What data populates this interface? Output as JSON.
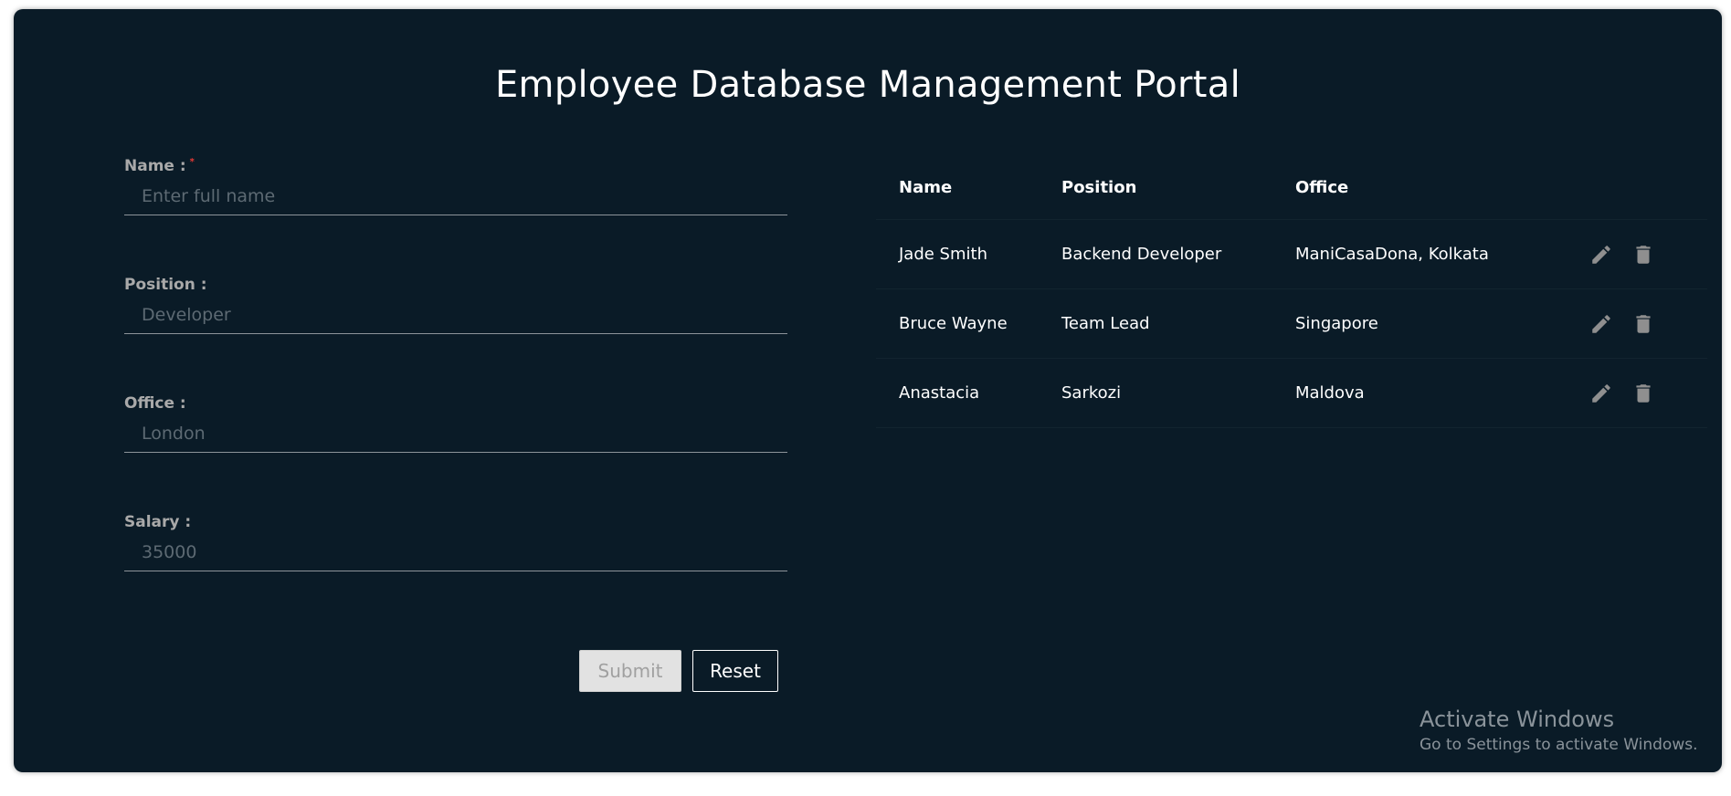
{
  "page": {
    "title": "Employee Database Management Portal"
  },
  "colors": {
    "background": "#0a1b27",
    "text": "#ffffff",
    "label": "#a9a9a9",
    "required": "#e53935",
    "icon": "#8f8f8f"
  },
  "form": {
    "name": {
      "label": "Name :",
      "required_mark": "*",
      "placeholder": "Enter full name",
      "value": ""
    },
    "position": {
      "label": "Position :",
      "placeholder": "Developer",
      "value": ""
    },
    "office": {
      "label": "Office :",
      "placeholder": "London",
      "value": ""
    },
    "salary": {
      "label": "Salary :",
      "placeholder": "35000",
      "value": ""
    },
    "submit_label": "Submit",
    "reset_label": "Reset"
  },
  "table": {
    "headers": {
      "name": "Name",
      "position": "Position",
      "office": "Office"
    },
    "rows": [
      {
        "name": "Jade Smith",
        "position": "Backend Developer",
        "office": "ManiCasaDona, Kolkata"
      },
      {
        "name": "Bruce Wayne",
        "position": "Team Lead",
        "office": "Singapore"
      },
      {
        "name": "Anastacia",
        "position": "Sarkozi",
        "office": "Maldova"
      }
    ],
    "row_actions": [
      "pencil-icon",
      "trash-icon"
    ]
  },
  "watermark": {
    "title": "Activate Windows",
    "subtitle": "Go to Settings to activate Windows."
  }
}
